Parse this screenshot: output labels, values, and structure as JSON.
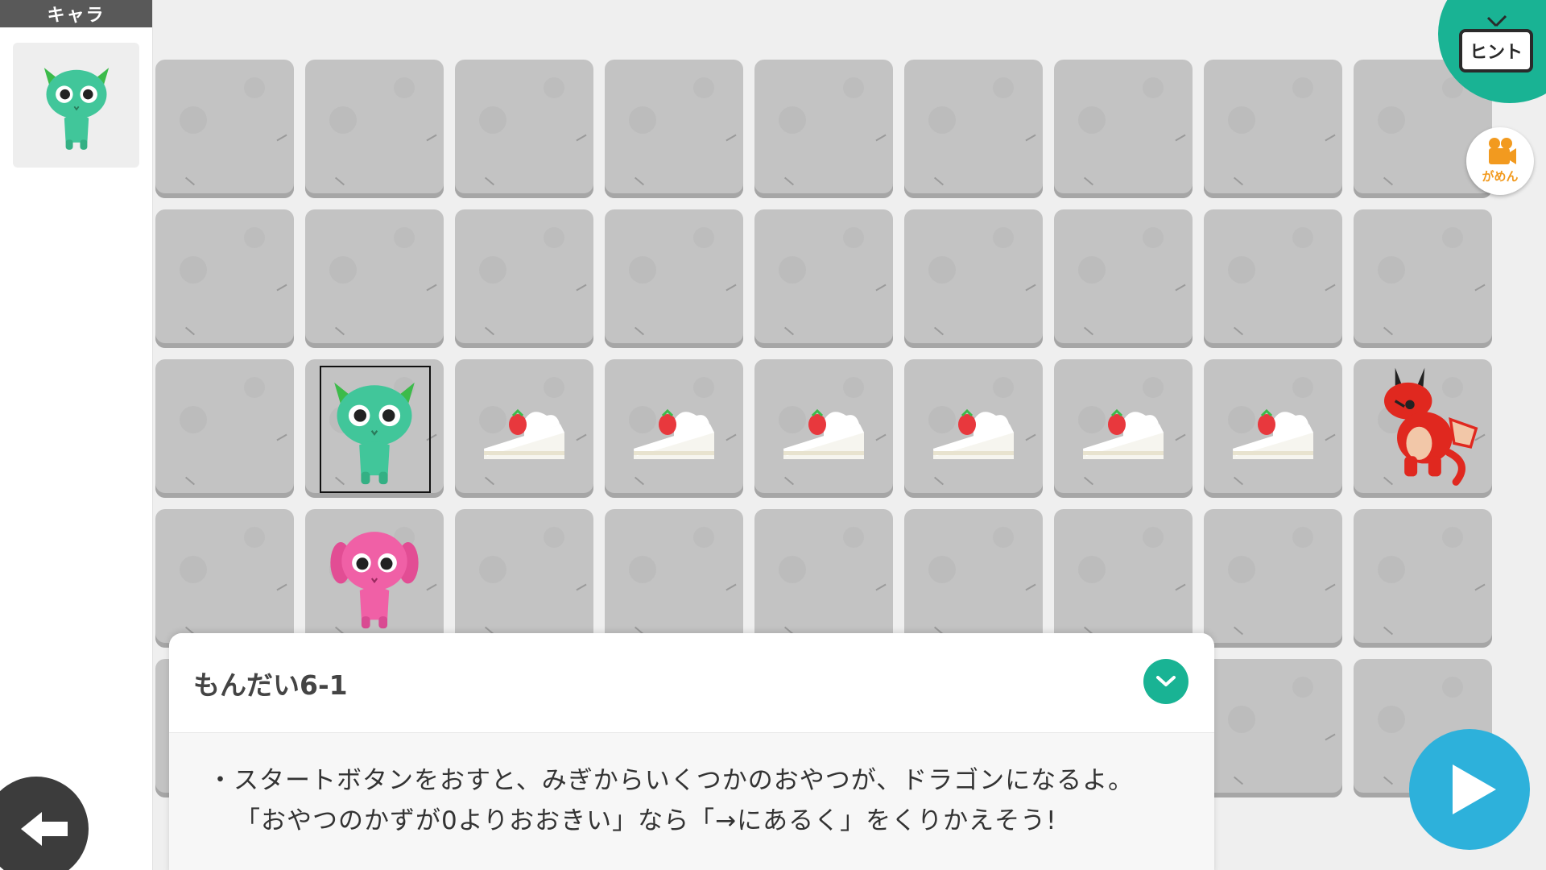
{
  "char_panel": {
    "header": "キャラ",
    "selected_character": "green-monster"
  },
  "board": {
    "rows": [
      [
        "empty",
        "empty",
        "empty",
        "empty",
        "empty",
        "empty",
        "empty",
        "empty",
        "empty"
      ],
      [
        "empty",
        "empty",
        "empty",
        "empty",
        "empty",
        "empty",
        "empty",
        "empty",
        "empty"
      ],
      [
        "empty",
        "green-monster",
        "cake",
        "cake",
        "cake",
        "cake",
        "cake",
        "cake",
        "red-dragon"
      ],
      [
        "empty",
        "pink-monster",
        "empty",
        "empty",
        "empty",
        "empty",
        "empty",
        "empty",
        "empty"
      ],
      [
        "empty",
        "empty",
        "empty",
        "empty",
        "empty",
        "empty",
        "empty",
        "empty",
        "empty"
      ]
    ]
  },
  "hint": {
    "label": "ヒント"
  },
  "camera": {
    "label": "がめん"
  },
  "problem": {
    "title": "もんだい6-1",
    "line1": "・スタートボタンをおすと、みぎからいくつかのおやつが、ドラゴンになるよ。",
    "line2": "「おやつのかずが0よりおおきい」なら「→にあるく」をくりかえそう!"
  },
  "colors": {
    "accent": "#19b394",
    "play": "#2db1db",
    "tile": "#c3c3c3",
    "back": "#3c3c3c"
  }
}
